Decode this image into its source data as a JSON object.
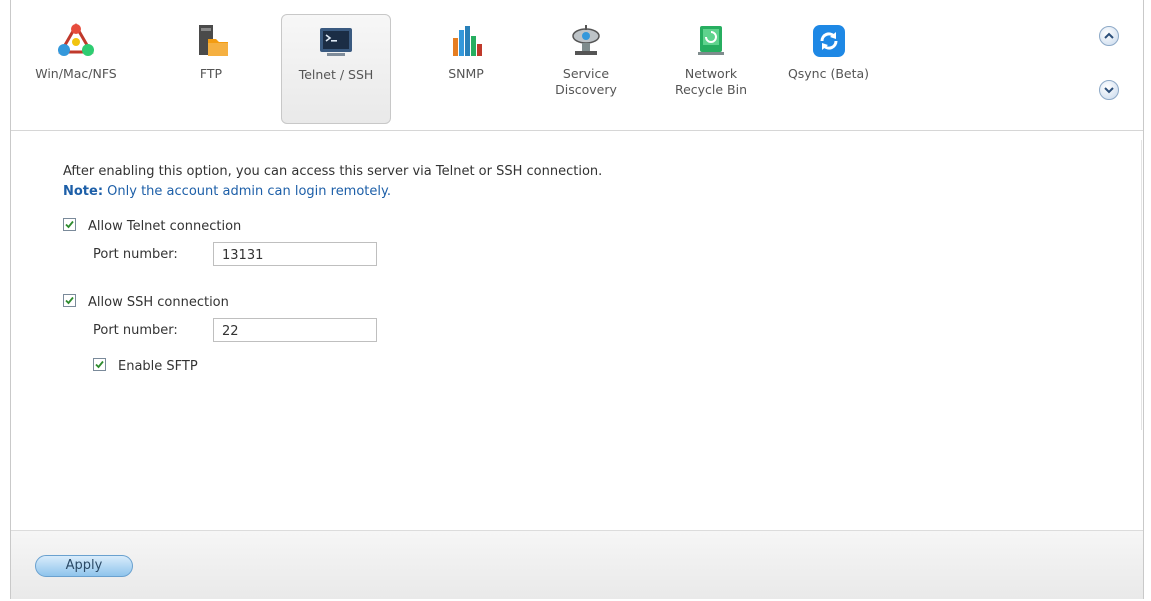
{
  "tabs": [
    {
      "label": "Win/Mac/NFS",
      "icon": "win-mac-nfs-icon"
    },
    {
      "label": "FTP",
      "icon": "ftp-icon"
    },
    {
      "label": "Telnet / SSH",
      "icon": "telnet-ssh-icon",
      "active": true
    },
    {
      "label": "SNMP",
      "icon": "snmp-icon"
    },
    {
      "label_line1": "Service",
      "label_line2": "Discovery",
      "icon": "service-discovery-icon"
    },
    {
      "label_line1": "Network",
      "label_line2": "Recycle Bin",
      "icon": "network-recycle-bin-icon"
    },
    {
      "label": "Qsync (Beta)",
      "icon": "qsync-icon"
    }
  ],
  "content": {
    "description": "After enabling this option, you can access this server via Telnet or SSH connection.",
    "note_label": "Note:",
    "note_text": " Only the account admin can login remotely.",
    "telnet": {
      "label": "Allow Telnet connection",
      "checked": true,
      "port_label": "Port number:",
      "port_value": "13131"
    },
    "ssh": {
      "label": "Allow SSH connection",
      "checked": true,
      "port_label": "Port number:",
      "port_value": "22"
    },
    "sftp": {
      "label": "Enable SFTP",
      "checked": true
    }
  },
  "footer": {
    "apply_label": "Apply"
  },
  "colors": {
    "accent": "#1d5fa8",
    "button": "#8fc4ec"
  }
}
